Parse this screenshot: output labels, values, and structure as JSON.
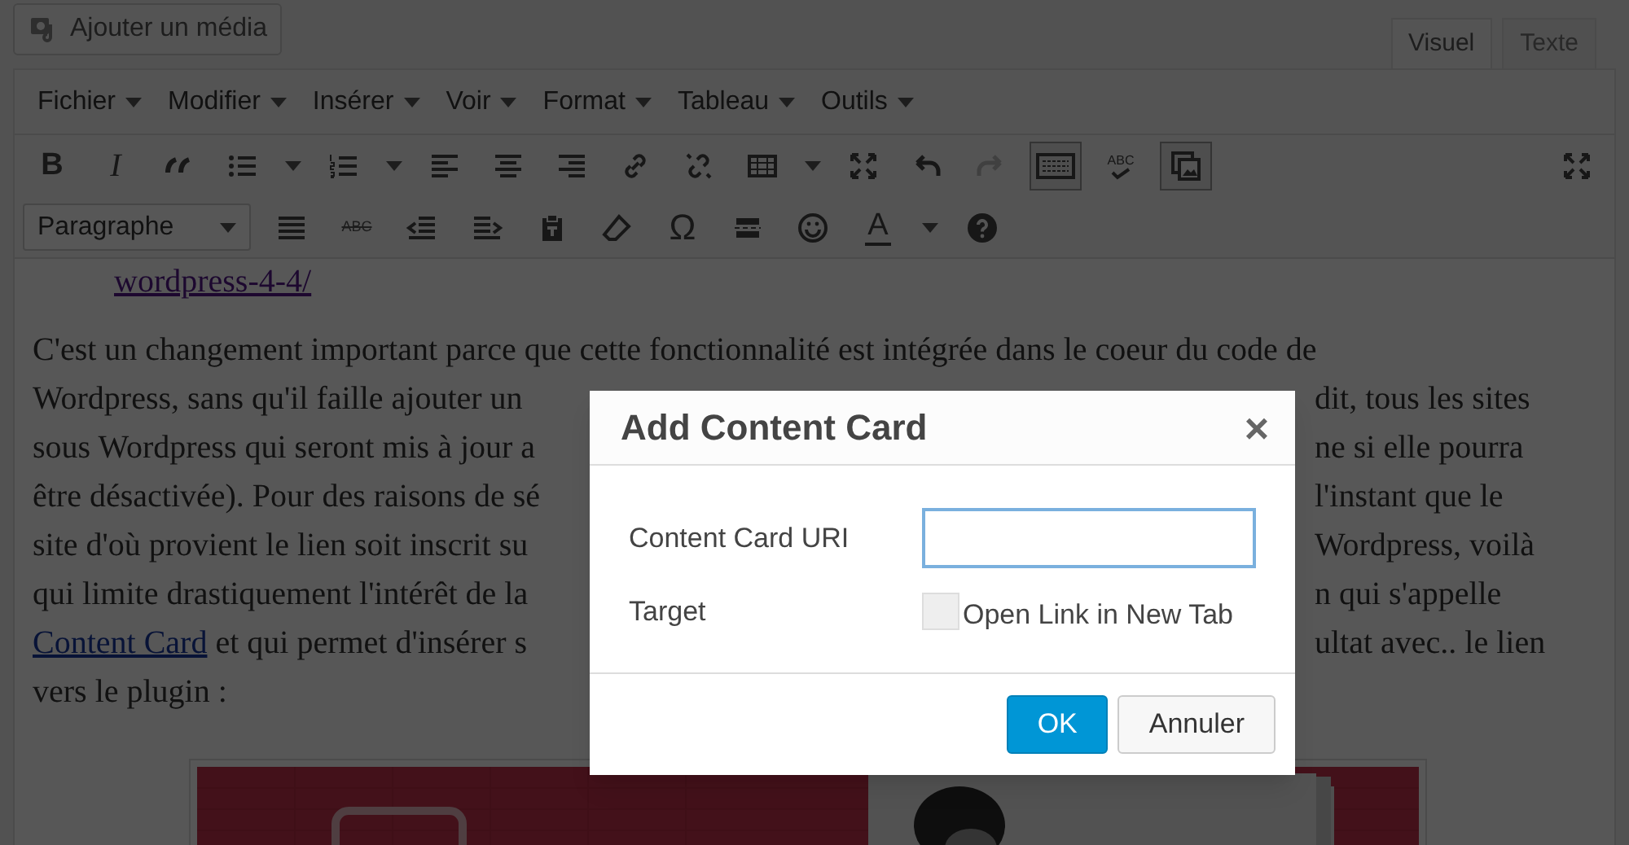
{
  "media_button": {
    "label": "Ajouter un média"
  },
  "tabs": [
    {
      "label": "Visuel",
      "selected": true
    },
    {
      "label": "Texte",
      "selected": false
    }
  ],
  "menu": [
    {
      "label": "Fichier"
    },
    {
      "label": "Modifier"
    },
    {
      "label": "Insérer"
    },
    {
      "label": "Voir"
    },
    {
      "label": "Format"
    },
    {
      "label": "Tableau"
    },
    {
      "label": "Outils"
    }
  ],
  "toolbar": {
    "bold": "B",
    "italic": "I",
    "spellcheck": "ABC",
    "strikethrough": "ABC",
    "special_character": "Ω",
    "text_color": "A",
    "format_select": "Paragraphe",
    "redo_disabled": true,
    "toggles": [
      {
        "pressed": true
      },
      {
        "pressed": true
      }
    ]
  },
  "content": {
    "link_tail": "wordpress-4-4/",
    "lines": [
      {
        "kind": "text",
        "left": "C'est un changement important parce que cette fonctionnalité est intégrée dans le coeur du code de"
      },
      {
        "kind": "text",
        "left": "Wordpress, sans qu'il faille ajouter un",
        "right": "dit, tous les sites"
      },
      {
        "kind": "text",
        "left": "sous Wordpress qui seront mis à jour a",
        "right": "ne si elle pourra"
      },
      {
        "kind": "text",
        "left": "être désactivée). Pour des raisons de sé",
        "right": "l'instant que le"
      },
      {
        "kind": "text",
        "left": "site d'où provient le lien soit inscrit su",
        "right": "Wordpress, voilà"
      },
      {
        "kind": "text",
        "left": "qui limite drastiquement l'intérêt de la",
        "right": "n qui s'appelle"
      },
      {
        "kind": "link_start",
        "link": "Content Card",
        "left": " et qui permet d'insérer s",
        "right": "ultat avec.. le lien"
      },
      {
        "kind": "text",
        "left": "vers le plugin  :"
      }
    ]
  },
  "dialog": {
    "title": "Add Content Card",
    "close": "×",
    "fields": [
      {
        "kind": "input",
        "label": "Content Card URI",
        "focused": true
      },
      {
        "kind": "checkbox",
        "label": "Target",
        "option": "Open Link in New Tab",
        "checked": false
      }
    ],
    "buttons": [
      {
        "label": "OK",
        "primary": true
      },
      {
        "label": "Annuler",
        "primary": false
      }
    ]
  }
}
